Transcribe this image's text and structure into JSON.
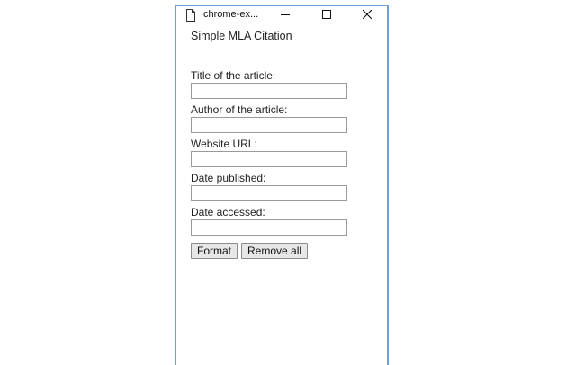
{
  "window": {
    "title": "chrome-ex...",
    "icons": {
      "page": "page-icon",
      "minimize": "minimize-icon",
      "maximize": "maximize-icon",
      "close": "close-icon"
    },
    "accent_border": "#6f9fd8"
  },
  "app": {
    "title": "Simple MLA Citation"
  },
  "form": {
    "fields": [
      {
        "label": "Title of the article:",
        "value": "",
        "placeholder": ""
      },
      {
        "label": "Author of the article:",
        "value": "",
        "placeholder": ""
      },
      {
        "label": "Website URL:",
        "value": "",
        "placeholder": ""
      },
      {
        "label": "Date published:",
        "value": "",
        "placeholder": ""
      },
      {
        "label": "Date accessed:",
        "value": "",
        "placeholder": ""
      }
    ],
    "format_label": "Format",
    "remove_all_label": "Remove all"
  }
}
